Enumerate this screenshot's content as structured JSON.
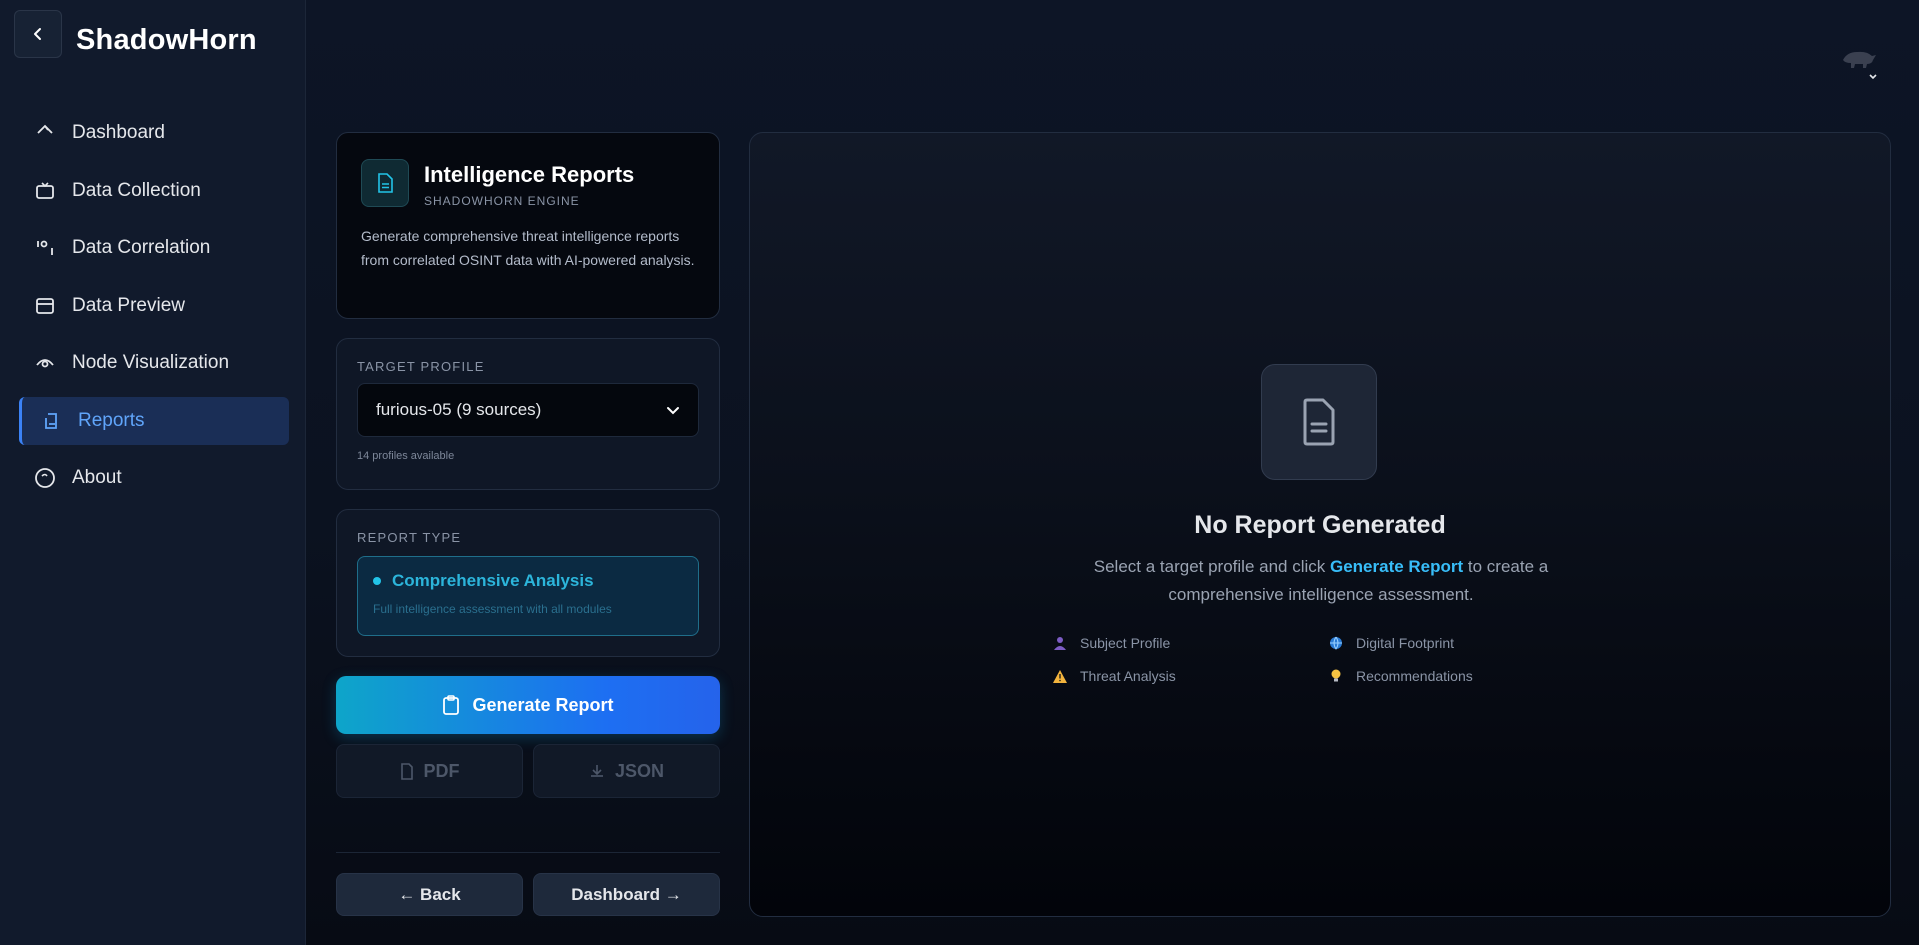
{
  "app": {
    "name": "ShadowHorn"
  },
  "sidebar": {
    "items": [
      {
        "label": "Dashboard",
        "icon": "dashboard-icon",
        "active": false
      },
      {
        "label": "Data Collection",
        "icon": "tv-icon",
        "active": false
      },
      {
        "label": "Data Correlation",
        "icon": "correlation-icon",
        "active": false
      },
      {
        "label": "Data Preview",
        "icon": "preview-icon",
        "active": false
      },
      {
        "label": "Node Visualization",
        "icon": "eye-icon",
        "active": false
      },
      {
        "label": "Reports",
        "icon": "reports-icon",
        "active": true
      },
      {
        "label": "About",
        "icon": "info-circle-icon",
        "active": false
      }
    ]
  },
  "intro": {
    "title": "Intelligence Reports",
    "subtitle": "SHADOWHORN ENGINE",
    "description": "Generate comprehensive threat intelligence reports from correlated OSINT data with AI-powered analysis."
  },
  "target_profile": {
    "label": "TARGET PROFILE",
    "selected": "furious-05 (9 sources)",
    "note": "14 profiles available"
  },
  "report_type": {
    "label": "REPORT TYPE",
    "option_title": "Comprehensive Analysis",
    "option_desc": "Full intelligence assessment with all modules"
  },
  "actions": {
    "generate": "Generate Report",
    "pdf": "PDF",
    "json": "JSON",
    "back": "← Back",
    "dashboard": "Dashboard →"
  },
  "empty_state": {
    "title": "No Report Generated",
    "desc_before": "Select a target profile and click ",
    "desc_highlight": "Generate Report",
    "desc_after": " to create a comprehensive intelligence assessment.",
    "features": [
      {
        "label": "Subject Profile",
        "icon": "person-icon"
      },
      {
        "label": "Digital Footprint",
        "icon": "globe-icon"
      },
      {
        "label": "Threat Analysis",
        "icon": "warning-icon"
      },
      {
        "label": "Recommendations",
        "icon": "lightbulb-icon"
      }
    ]
  },
  "colors": {
    "accent": "#3b82f6",
    "cyan": "#0ea5c9",
    "highlight": "#38bdf8"
  }
}
